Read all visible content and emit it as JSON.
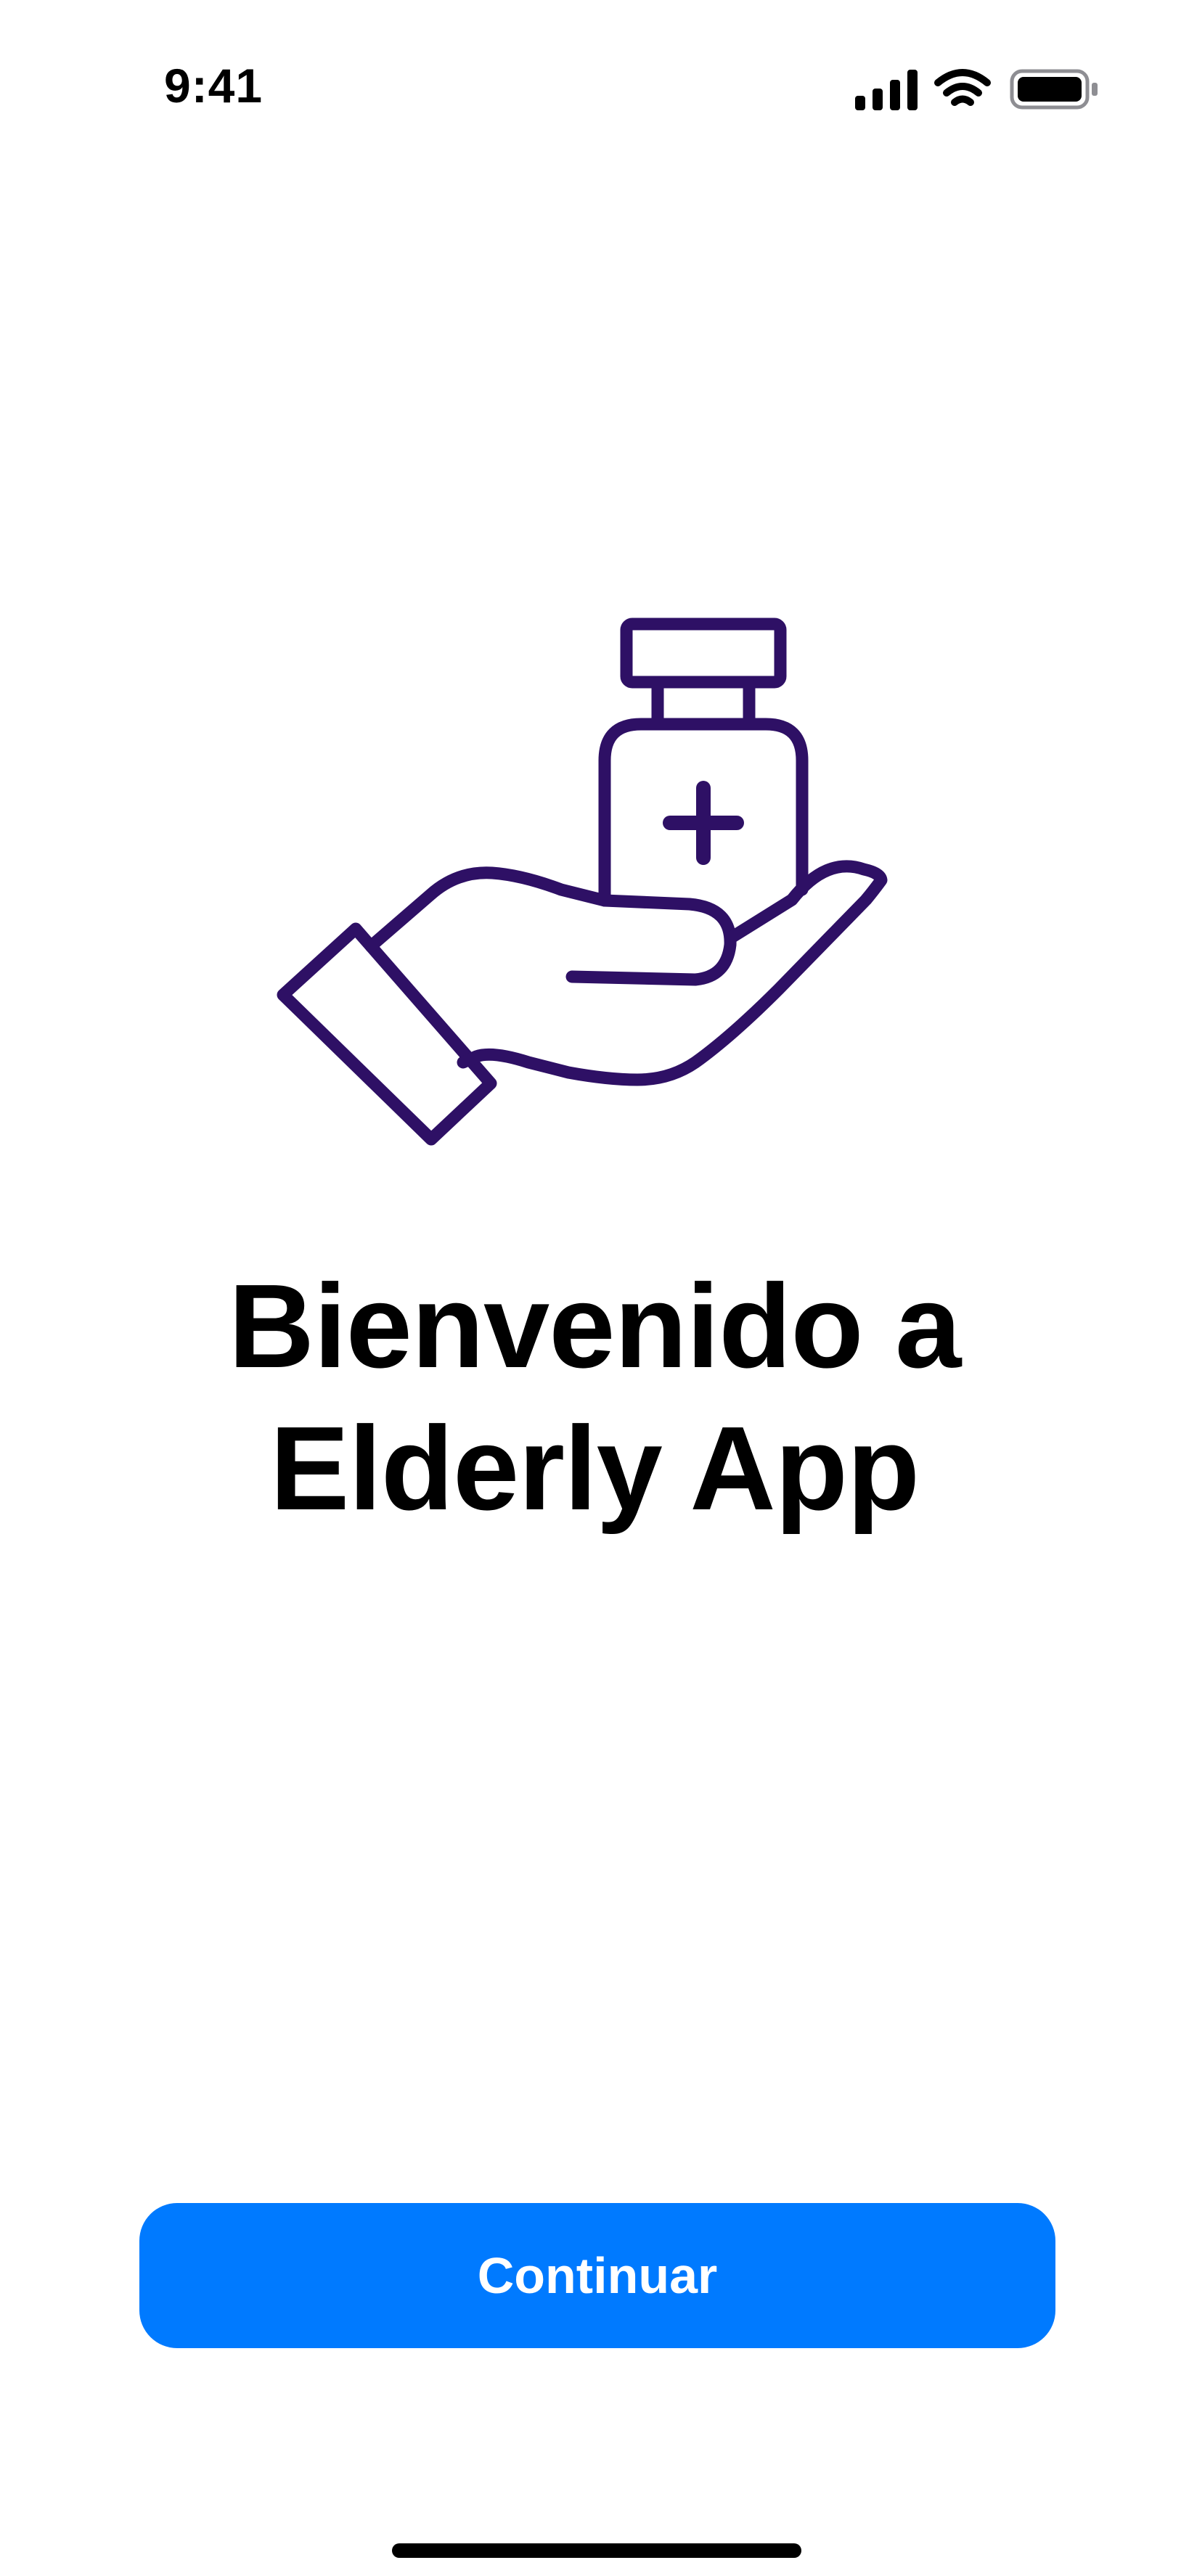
{
  "status_bar": {
    "time": "9:41",
    "icons": [
      "cellular-signal-icon",
      "wifi-icon",
      "battery-icon"
    ]
  },
  "hero": {
    "icon": "hand-holding-medicine-icon",
    "color": "#2E1065"
  },
  "welcome": {
    "title_line1": "Bienvenido a",
    "title_line2": "Elderly App"
  },
  "actions": {
    "continue_label": "Continuar",
    "button_color": "#007AFF"
  }
}
